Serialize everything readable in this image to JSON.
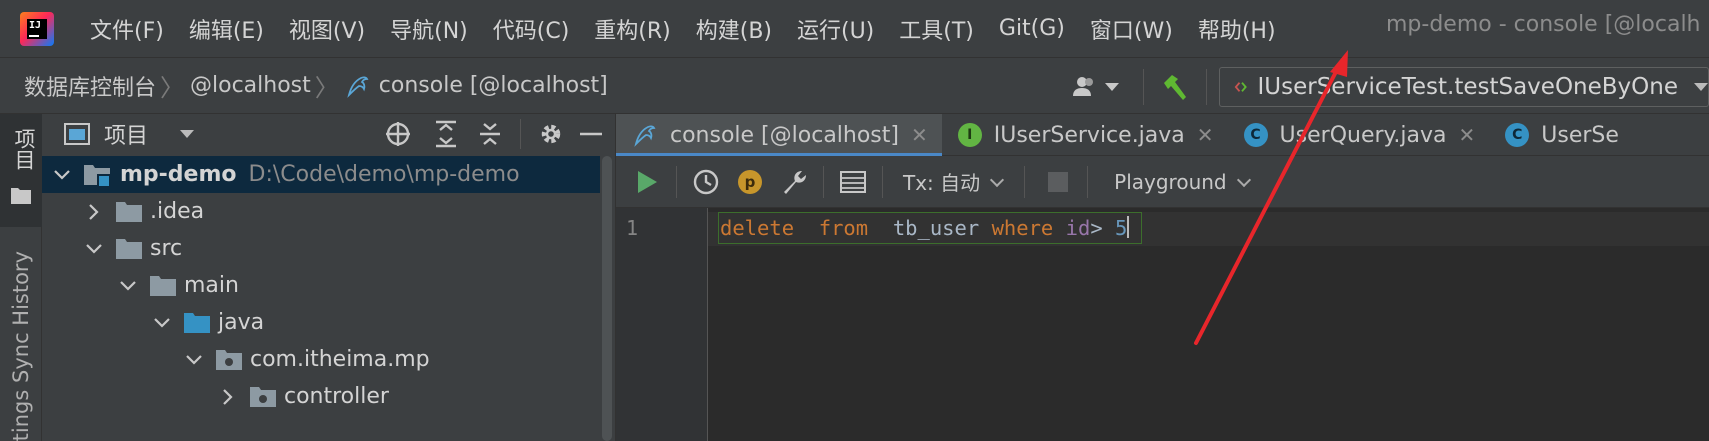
{
  "menu_bar": {
    "items": [
      "文件(F)",
      "编辑(E)",
      "视图(V)",
      "导航(N)",
      "代码(C)",
      "重构(R)",
      "构建(B)",
      "运行(U)",
      "工具(T)",
      "Git(G)",
      "窗口(W)",
      "帮助(H)"
    ],
    "window_title": "mp-demo - console [@localh"
  },
  "nav_bar": {
    "breadcrumbs": [
      "数据库控制台",
      "@localhost",
      "console [@localhost]"
    ],
    "run_config": "IUserServiceTest.testSaveOneByOne"
  },
  "tool_strip": {
    "project_label": "项目",
    "settings_sync_label": "tings Sync History"
  },
  "project_panel": {
    "title": "项目",
    "tree": [
      {
        "name": "mp-demo",
        "path": "D:\\Code\\demo\\mp-demo",
        "expanded": true,
        "selected": true
      },
      {
        "name": ".idea",
        "expanded": false
      },
      {
        "name": "src",
        "expanded": true
      },
      {
        "name": "main",
        "expanded": true
      },
      {
        "name": "java",
        "expanded": true
      },
      {
        "name": "com.itheima.mp",
        "expanded": true
      },
      {
        "name": "controller",
        "expanded": false
      }
    ]
  },
  "editor": {
    "tabs": [
      {
        "label": "console [@localhost]",
        "icon": "mysql-dolphin-icon",
        "active": true
      },
      {
        "label": "IUserService.java",
        "icon": "interface-icon",
        "icon_letter": "I"
      },
      {
        "label": "UserQuery.java",
        "icon": "class-icon",
        "icon_letter": "C"
      },
      {
        "label": "UserSe",
        "icon": "class-icon",
        "icon_letter": "C"
      }
    ],
    "toolbar": {
      "tx_label": "Tx: 自动",
      "playground_label": "Playground"
    },
    "line_number": "1",
    "code": {
      "kw_delete": "delete",
      "kw_from": "from",
      "table": "tb_user",
      "kw_where": "where",
      "column": "id",
      "operator": ">",
      "value": "5"
    }
  },
  "colors": {
    "accent_tab": "#4a88c7",
    "keyword": "#cc7832",
    "number": "#6897bb",
    "annotation_arrow": "#e8262b"
  }
}
